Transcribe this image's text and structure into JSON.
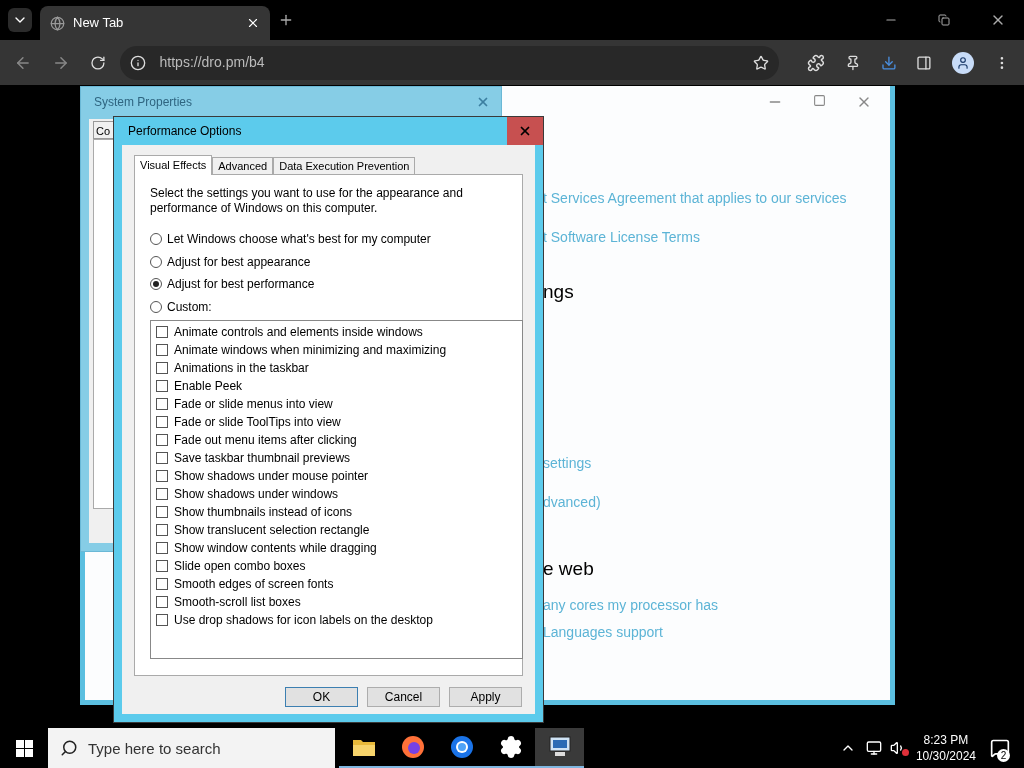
{
  "browser": {
    "tabs": [
      {
        "label": "New Tab",
        "selected": true
      }
    ],
    "url": "https://dro.pm/b4"
  },
  "settings_window": {
    "links_top": [
      "t Services Agreement that applies to our services",
      "t Software License Terms"
    ],
    "heading_1": "ngs",
    "links_middle": [
      "settings",
      "dvanced)"
    ],
    "heading_2": "e web",
    "links_bottom": [
      "any cores my processor has",
      "Languages support"
    ]
  },
  "system_properties": {
    "title": "System Properties",
    "tab": "Co"
  },
  "performance_options": {
    "title": "Performance Options",
    "tabs": [
      {
        "label": "Visual Effects",
        "selected": true
      },
      {
        "label": "Advanced",
        "selected": false
      },
      {
        "label": "Data Execution Prevention",
        "selected": false
      }
    ],
    "description": "Select the settings you want to use for the appearance and performance of Windows on this computer.",
    "options": [
      {
        "label": "Let Windows choose what's best for my computer",
        "selected": false
      },
      {
        "label": "Adjust for best appearance",
        "selected": false
      },
      {
        "label": "Adjust for best performance",
        "selected": true
      },
      {
        "label": "Custom:",
        "selected": false
      }
    ],
    "effects": [
      {
        "label": "Animate controls and elements inside windows",
        "checked": false
      },
      {
        "label": "Animate windows when minimizing and maximizing",
        "checked": false
      },
      {
        "label": "Animations in the taskbar",
        "checked": false
      },
      {
        "label": "Enable Peek",
        "checked": false
      },
      {
        "label": "Fade or slide menus into view",
        "checked": false
      },
      {
        "label": "Fade or slide ToolTips into view",
        "checked": false
      },
      {
        "label": "Fade out menu items after clicking",
        "checked": false
      },
      {
        "label": "Save taskbar thumbnail previews",
        "checked": false
      },
      {
        "label": "Show shadows under mouse pointer",
        "checked": false
      },
      {
        "label": "Show shadows under windows",
        "checked": false
      },
      {
        "label": "Show thumbnails instead of icons",
        "checked": false
      },
      {
        "label": "Show translucent selection rectangle",
        "checked": false
      },
      {
        "label": "Show window contents while dragging",
        "checked": false
      },
      {
        "label": "Slide open combo boxes",
        "checked": false
      },
      {
        "label": "Smooth edges of screen fonts",
        "checked": false
      },
      {
        "label": "Smooth-scroll list boxes",
        "checked": false
      },
      {
        "label": "Use drop shadows for icon labels on the desktop",
        "checked": false
      }
    ],
    "buttons": [
      "OK",
      "Cancel",
      "Apply"
    ]
  },
  "taskbar": {
    "search_placeholder": "Type here to search",
    "apps": [
      {
        "kind": "folder",
        "selected": false
      },
      {
        "kind": "firefox",
        "selected": false
      },
      {
        "kind": "chrome",
        "selected": false
      },
      {
        "kind": "gear",
        "selected": false
      },
      {
        "kind": "system",
        "selected": true
      }
    ],
    "time": "8:23 PM",
    "date": "10/30/2024",
    "notifications": "2"
  }
}
